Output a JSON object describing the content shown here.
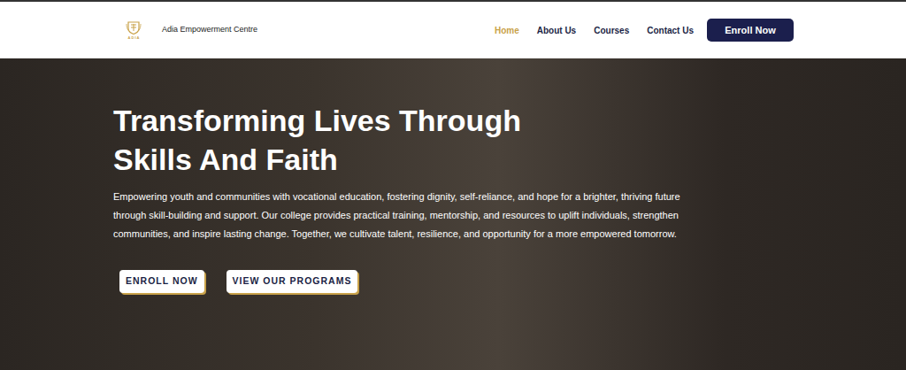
{
  "nav": {
    "logo_text": "A D I A",
    "brand": "Adia Empowerment Centre",
    "links": [
      {
        "label": "Home",
        "selected": true
      },
      {
        "label": "About Us",
        "selected": false
      },
      {
        "label": "Courses",
        "selected": false
      },
      {
        "label": "Contact Us",
        "selected": false
      }
    ],
    "cta": "Enroll Now"
  },
  "hero": {
    "title": "Transforming Lives Through Skills And Faith",
    "description": "Empowering youth and communities with vocational education, fostering dignity, self-reliance, and hope for a brighter, thriving future through skill-building and support. Our college provides practical training, mentorship, and resources to uplift individuals, strengthen communities, and inspire lasting change. Together, we cultivate talent, resilience, and opportunity for a more empowered tomorrow.",
    "buttons": [
      "ENROLL NOW",
      "VIEW OUR PROGRAMS"
    ]
  }
}
